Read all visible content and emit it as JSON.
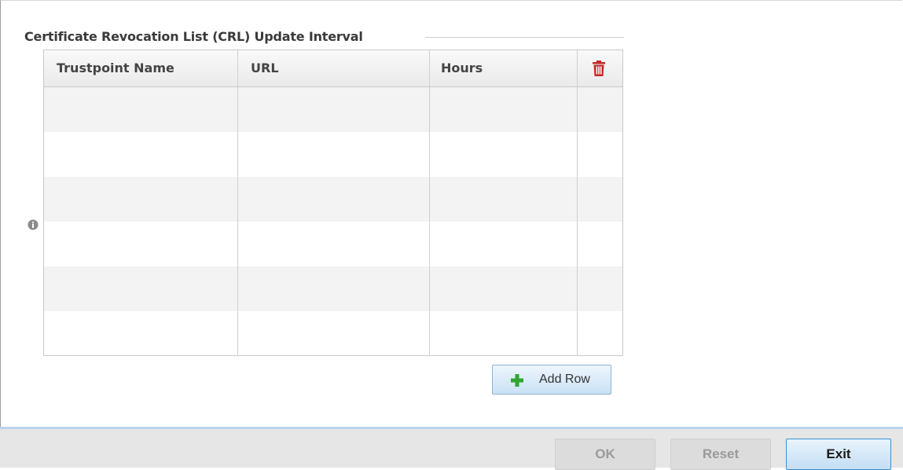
{
  "crl_section": {
    "heading": "Certificate Revocation List (CRL) Update Interval",
    "info_icon": "info-icon",
    "table": {
      "columns": [
        "Trustpoint Name",
        "URL",
        "Hours"
      ],
      "delete_icon": "trash-icon",
      "rows": []
    },
    "add_row_label": "Add Row",
    "add_row_icon": "plus-icon"
  },
  "footer": {
    "ok_label": "OK",
    "reset_label": "Reset",
    "exit_label": "Exit"
  },
  "colors": {
    "delete_icon": "#c62828",
    "add_icon": "#2fa52f",
    "button_accent": "#3b8fd1"
  }
}
